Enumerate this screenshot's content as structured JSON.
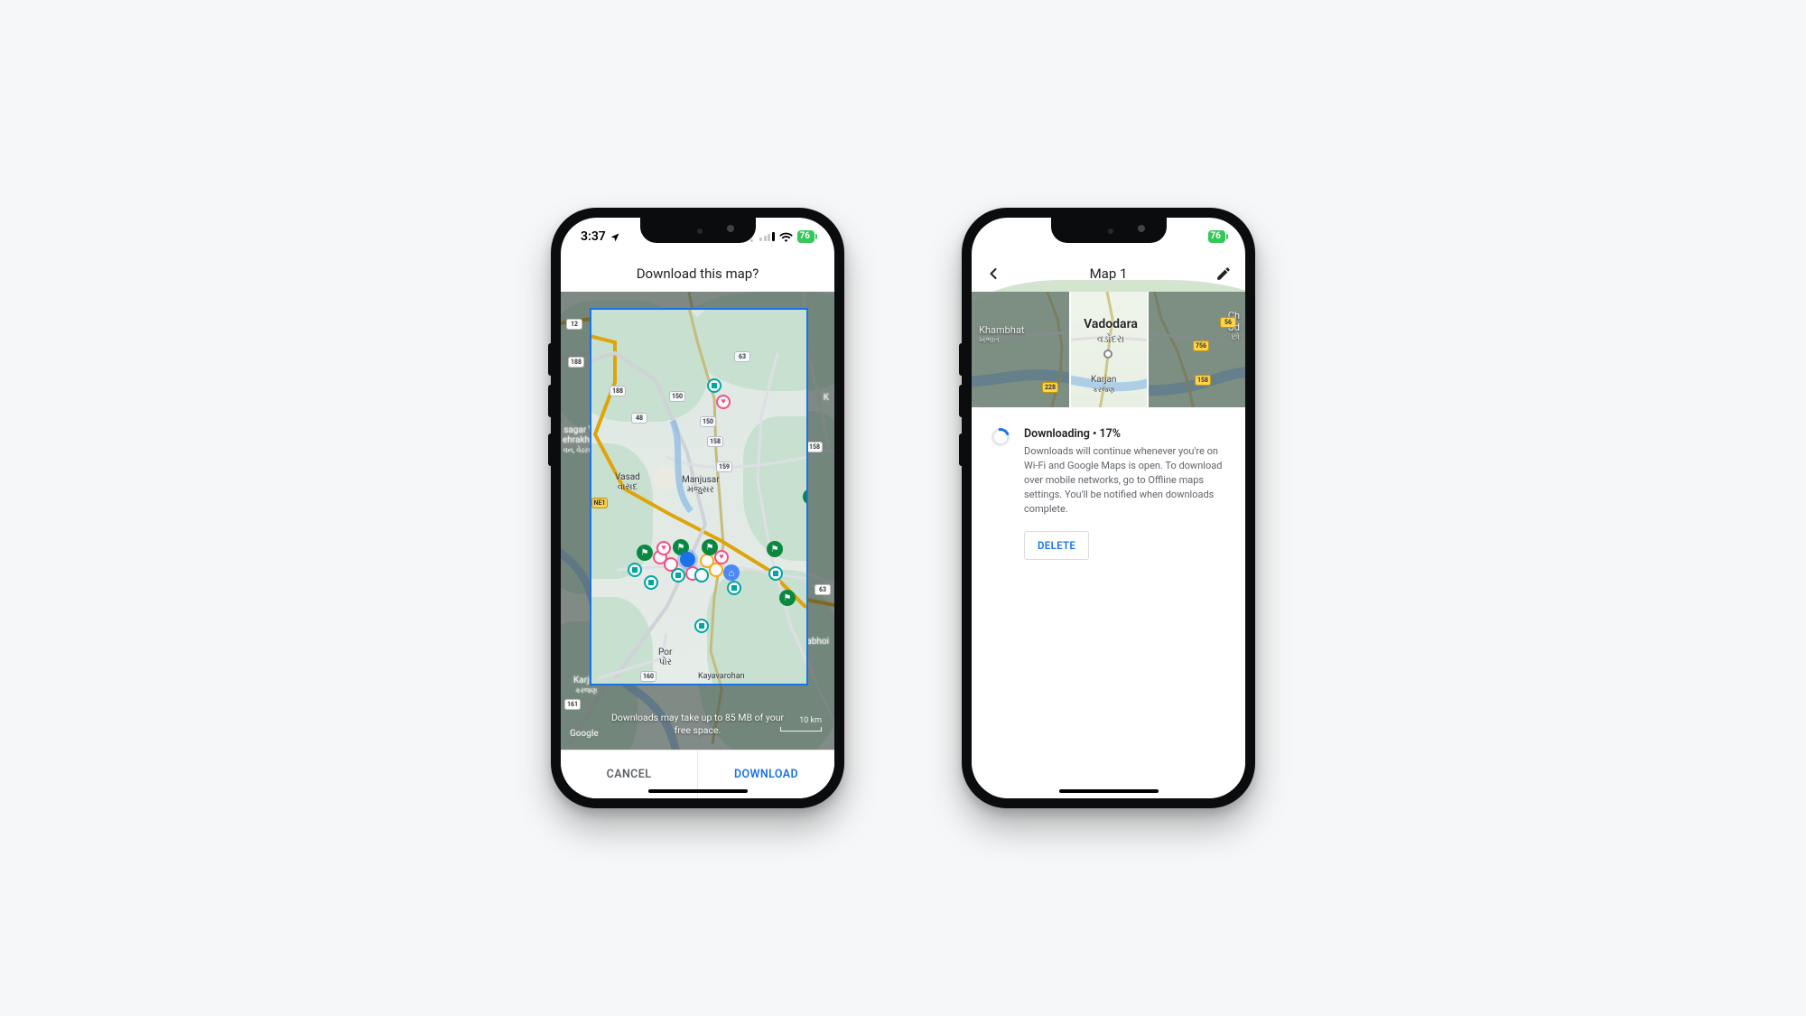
{
  "phone1": {
    "status": {
      "time": "3:37",
      "battery": "76"
    },
    "header_title": "Download this map?",
    "note_line1": "Downloads may take up to 85 MB of your",
    "note_line2": "free space.",
    "scale_label": "10 km",
    "google_logo": "Google",
    "cancel_label": "CANCEL",
    "download_label": "DOWNLOAD",
    "labels": {
      "ehrakhadi_1": "sagar Van",
      "ehrakhadi_2": "ehrakhadi)",
      "ehrakhadi_sub": "વન, વેઢરખાડી)",
      "vasad": "Vasad",
      "vasad_sub": "વાસદ",
      "manjusar": "Manjusar",
      "manjusar_sub": "મંજુસર",
      "por": "Por",
      "por_sub": "પોર",
      "karjan": "Karjan",
      "karjan_sub": "કરજણ",
      "dabhoi": "Dabhoi",
      "kayavarohan": "Kayavarohan",
      "saniyad": "K"
    },
    "shields": {
      "ne1": "NE1",
      "s12": "12",
      "s188": "188",
      "s188b": "188",
      "s48": "48",
      "s150": "150",
      "s150b": "150",
      "s63a": "63",
      "s63b": "63",
      "s158": "158",
      "s158b": "158",
      "s159": "159",
      "s160": "160",
      "s161": "161"
    }
  },
  "phone2": {
    "status": {
      "battery": "76"
    },
    "header_title": "Map 1",
    "city": "Vadodara",
    "city_native": "વડોદરા",
    "karjan": "Karjan",
    "karjan_sub": "કરજણ",
    "khambhat": "Khambhat",
    "khambhat_sub": "ખંભાત",
    "chud1": "Ch",
    "chud2": "Ud",
    "chud_sub": "છો",
    "status_title": "Downloading • 17%",
    "status_desc": "Downloads will continue whenever you're on Wi-Fi and Google Maps is open. To download over mobile networks, go to Offline maps settings. You'll be notified when downloads complete.",
    "delete_label": "DELETE",
    "shields": {
      "s56": "56",
      "s756": "756",
      "s158": "158",
      "s228": "228"
    }
  }
}
